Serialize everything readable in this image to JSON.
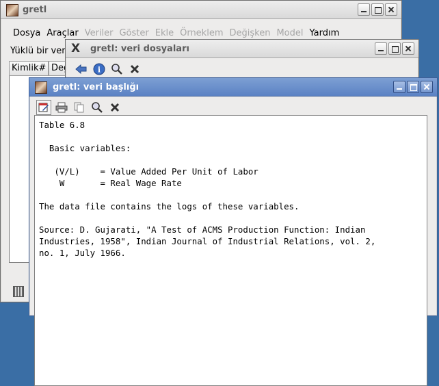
{
  "main_window": {
    "title": "gretl",
    "menu": [
      {
        "label": "Dosya",
        "enabled": true
      },
      {
        "label": "Araçlar",
        "enabled": true
      },
      {
        "label": "Veriler",
        "enabled": false
      },
      {
        "label": "Göster",
        "enabled": false
      },
      {
        "label": "Ekle",
        "enabled": false
      },
      {
        "label": "Örneklem",
        "enabled": false
      },
      {
        "label": "Değişken",
        "enabled": false
      },
      {
        "label": "Model",
        "enabled": false
      },
      {
        "label": "Yardım",
        "enabled": true
      }
    ],
    "status_text": "Yüklü bir veri",
    "column_headers": [
      "Kimlik#",
      "Değ"
    ]
  },
  "files_window": {
    "title": "gretl: veri dosyaları",
    "toolbar": [
      {
        "icon": "back-arrow-icon",
        "glyph": "⬅"
      },
      {
        "icon": "info-icon",
        "glyph": "i"
      },
      {
        "icon": "magnifier-icon",
        "glyph": "🔍"
      },
      {
        "icon": "close-icon",
        "glyph": "✖"
      }
    ]
  },
  "header_window": {
    "title": "gretl: veri başlığı",
    "toolbar": [
      {
        "icon": "edit-icon"
      },
      {
        "icon": "print-icon"
      },
      {
        "icon": "copy-icon"
      },
      {
        "icon": "magnifier-icon"
      },
      {
        "icon": "close-icon"
      }
    ],
    "text": "Table 6.8\n\n  Basic variables:\n\n   (V/L)    = Value Added Per Unit of Labor\n    W       = Real Wage Rate\n\nThe data file contains the logs of these variables.\n\nSource: D. Gujarati, \"A Test of ACMS Production Function: Indian\nIndustries, 1958\", Indian Journal of Industrial Relations, vol. 2,\nno. 1, July 1966."
  }
}
